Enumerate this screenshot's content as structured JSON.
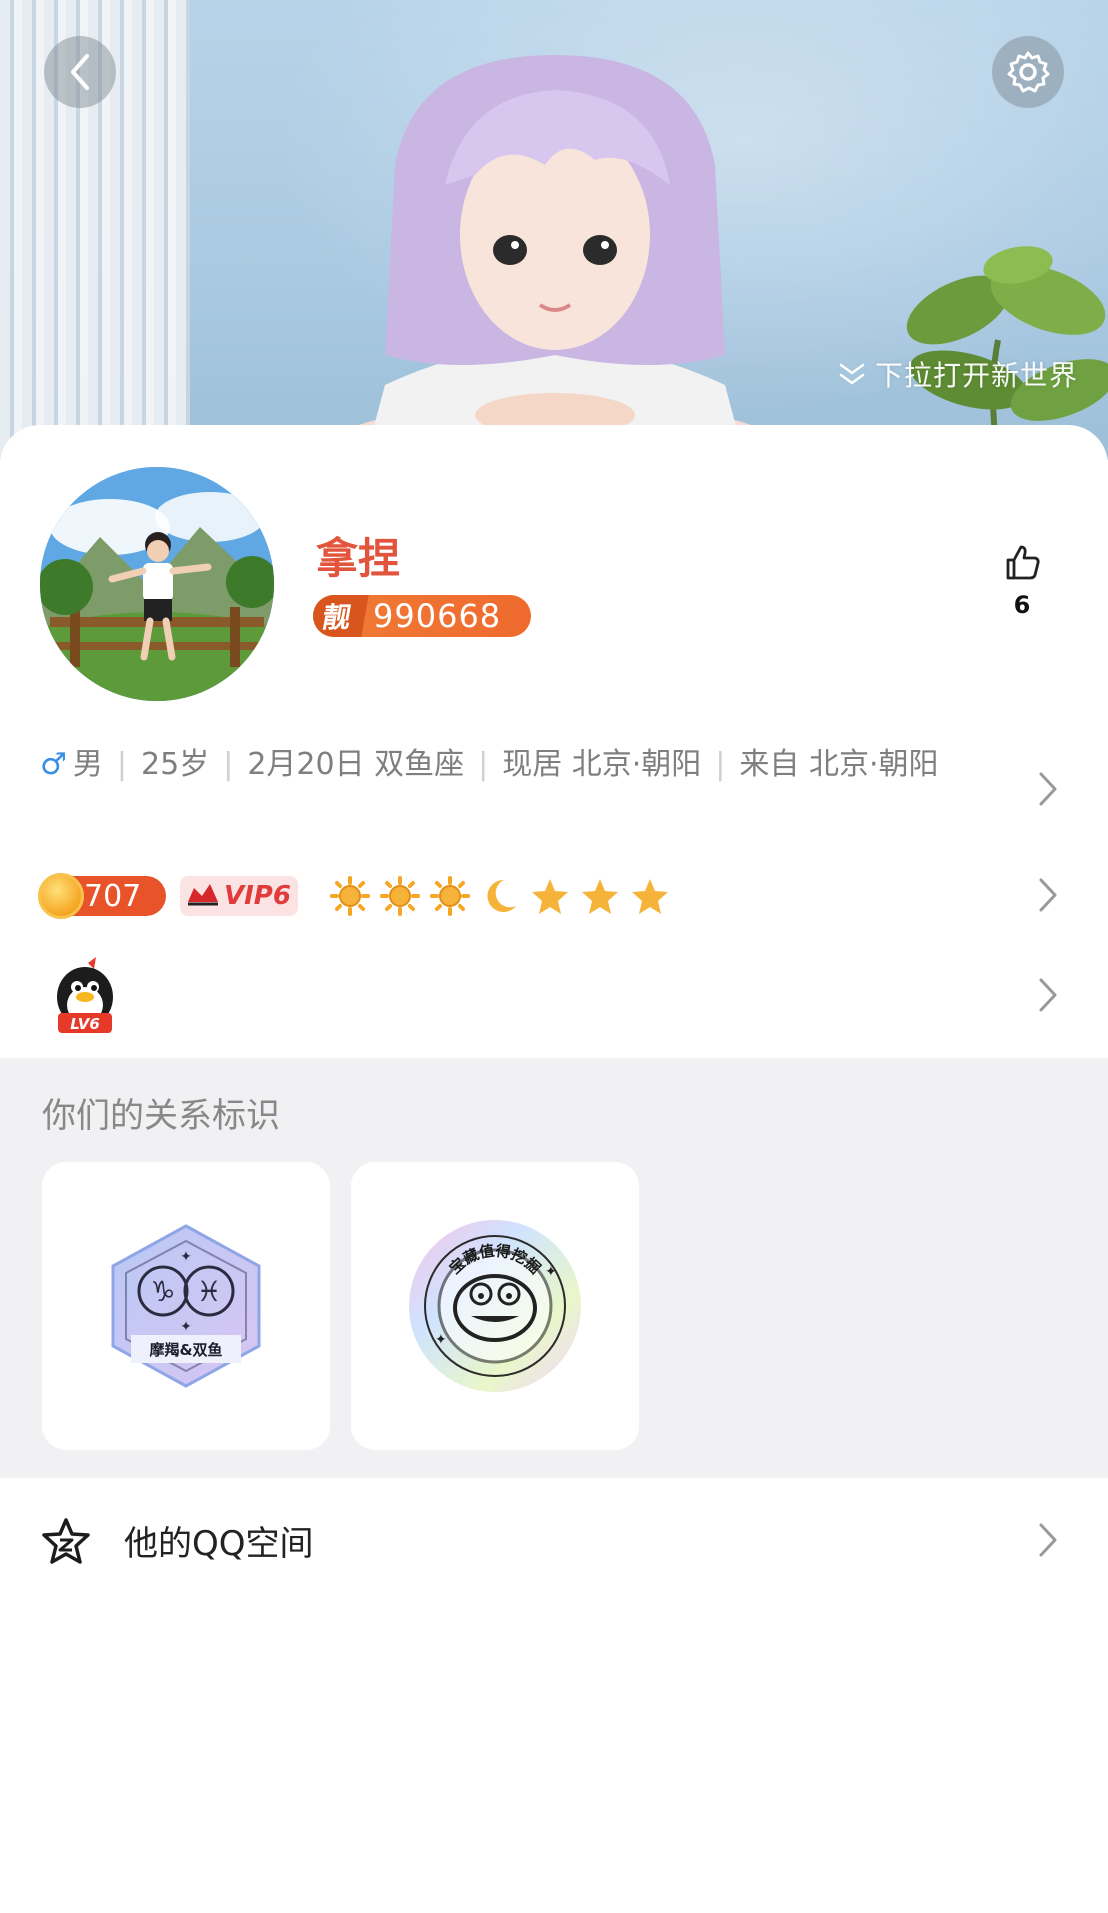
{
  "header": {
    "pull_hint": "下拉打开新世界"
  },
  "profile": {
    "name": "拿捏",
    "pretty_number_tag": "靓",
    "pretty_number": "990668",
    "likes": "6"
  },
  "info": {
    "gender_symbol": "♂",
    "gender": "男",
    "age": "25岁",
    "birthday": "2月20日 双鱼座",
    "residence": "现居 北京·朝阳",
    "hometown": "来自 北京·朝阳"
  },
  "levels": {
    "coin_count": "707",
    "vip": "VIP6",
    "level_icons": [
      "sun-icon",
      "sun-icon",
      "sun-icon",
      "moon-icon",
      "star-icon",
      "star-icon",
      "star-icon"
    ],
    "qq_level": "LV6"
  },
  "relation": {
    "title": "你们的关系标识",
    "badges": [
      {
        "label": "摩羯&双鱼"
      },
      {
        "label": "宝藏值得挖掘"
      }
    ]
  },
  "qzone": {
    "label": "他的QQ空间"
  },
  "colors": {
    "name": "#e2553c",
    "pretty_badge": "#ef6a2e",
    "vip_red": "#e23b3b",
    "male_blue": "#3a8ee6"
  }
}
